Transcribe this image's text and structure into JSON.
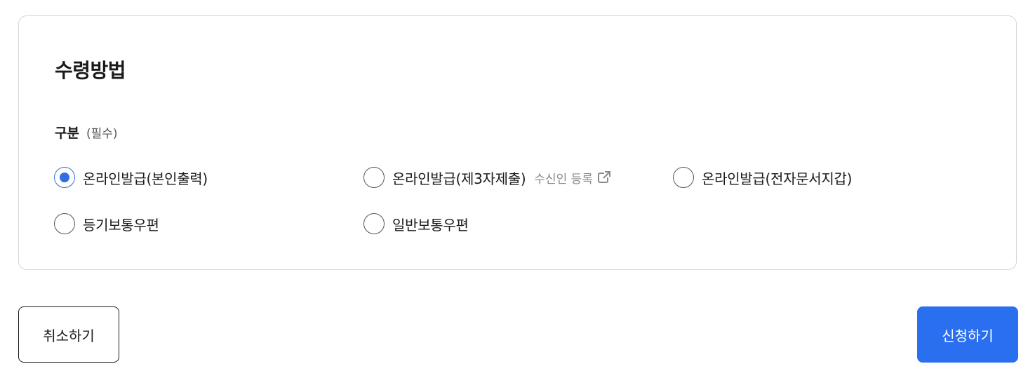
{
  "section": {
    "title": "수령방법",
    "field_label": "구분",
    "field_required": "(필수)"
  },
  "options": [
    {
      "label": "온라인발급(본인출력)",
      "selected": true
    },
    {
      "label": "온라인발급(제3자제출)",
      "selected": false,
      "link_label": "수신인 등록",
      "link_icon": "external-link-icon"
    },
    {
      "label": "온라인발급(전자문서지갑)",
      "selected": false
    },
    {
      "label": "등기보통우편",
      "selected": false
    },
    {
      "label": "일반보통우편",
      "selected": false
    }
  ],
  "buttons": {
    "cancel_label": "취소하기",
    "submit_label": "신청하기"
  },
  "colors": {
    "accent": "#2a6ff0",
    "border": "#d6d6d6"
  }
}
